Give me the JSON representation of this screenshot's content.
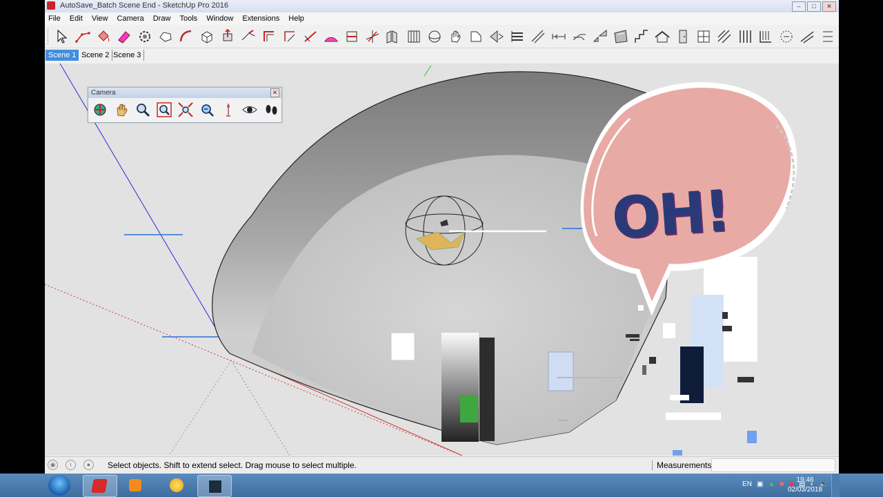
{
  "window": {
    "title": "AutoSave_Batch Scene End - SketchUp Pro 2016",
    "controls": {
      "minimize": "–",
      "maximize": "□",
      "close": "✕"
    }
  },
  "menu": [
    "File",
    "Edit",
    "View",
    "Camera",
    "Draw",
    "Tools",
    "Window",
    "Extensions",
    "Help"
  ],
  "scenes": [
    "Scene 1",
    "Scene 2",
    "Scene 3"
  ],
  "active_scene": "Scene 1",
  "camera_toolbar": {
    "title": "Camera",
    "close": "✕",
    "tools": [
      "orbit-icon",
      "pan-icon",
      "zoom-icon",
      "zoom-window-icon",
      "zoom-extents-icon",
      "previous-view-icon",
      "position-camera-icon",
      "look-around-icon",
      "walk-icon"
    ]
  },
  "status": {
    "message": "Select objects. Shift to extend select. Drag mouse to select multiple.",
    "measurements_label": "Measurements",
    "measurements_value": ""
  },
  "overlay": {
    "text": "OH!"
  },
  "taskbar": {
    "language": "EN",
    "time": "19:46",
    "date": "02/03/2018",
    "apps": [
      "windows-start-icon",
      "sketchup-icon",
      "media-player-icon",
      "paint-icon",
      "editor-icon"
    ]
  },
  "colors": {
    "accent": "#3f8ee0",
    "bubble": "#e8aaa5",
    "bubble_text": "#2a3a78"
  }
}
